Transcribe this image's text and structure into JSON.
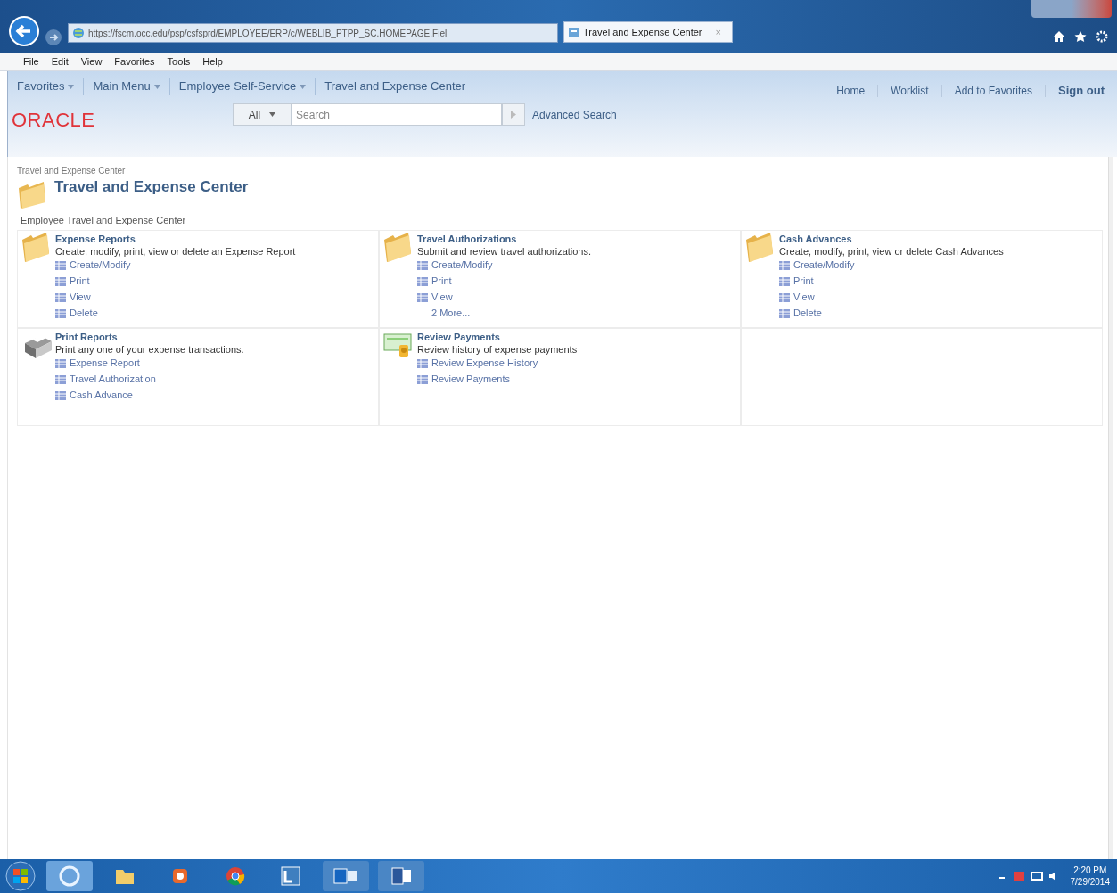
{
  "browser": {
    "address": "https://fscm.occ.edu/psp/csfsprd/EMPLOYEE/ERP/c/WEBLIB_PTPP_SC.HOMEPAGE.Fiel",
    "tabs": [
      {
        "label": "Travel and Expense Center",
        "selected": true,
        "close": "×"
      }
    ],
    "menu": [
      "File",
      "Edit",
      "View",
      "Favorites",
      "Tools",
      "Help"
    ]
  },
  "navbar": {
    "items": [
      {
        "label": "Favorites",
        "kind": "dropdown"
      },
      {
        "label": "Main Menu",
        "kind": "dropdown"
      },
      {
        "label": "Employee Self-Service",
        "kind": "dropdown"
      },
      {
        "label": "Travel and Expense Center",
        "kind": "plain"
      }
    ]
  },
  "header": {
    "logo": "ORACLE",
    "scope": "All",
    "search": {
      "placeholder": "Search"
    },
    "advanced": "Advanced Search",
    "links": [
      "Home",
      "Worklist",
      "Add to Favorites",
      "Sign out"
    ]
  },
  "page": {
    "breadcrumb": "Travel and Expense Center",
    "title": "Travel and Expense Center",
    "section": "Employee Travel and Expense Center",
    "tiles": [
      {
        "kind": "folder",
        "title": "Expense Reports",
        "description": "Create, modify, print, view or delete an Expense Report",
        "links": [
          {
            "label": "Create/Modify",
            "kind": "link"
          },
          {
            "label": "Print",
            "kind": "link"
          },
          {
            "label": "View",
            "kind": "link"
          },
          {
            "label": "Delete",
            "kind": "link"
          }
        ]
      },
      {
        "kind": "folder",
        "title": "Travel Authorizations",
        "description": "Submit and review travel authorizations.",
        "links": [
          {
            "label": "Create/Modify",
            "kind": "link"
          },
          {
            "label": "Print",
            "kind": "link"
          },
          {
            "label": "View",
            "kind": "link"
          },
          {
            "label": "2 More...",
            "kind": "more"
          }
        ]
      },
      {
        "kind": "folder",
        "title": "Cash Advances",
        "description": "Create, modify, print, view or delete Cash Advances",
        "links": [
          {
            "label": "Create/Modify",
            "kind": "link"
          },
          {
            "label": "Print",
            "kind": "link"
          },
          {
            "label": "View",
            "kind": "link"
          },
          {
            "label": "Delete",
            "kind": "link"
          }
        ]
      },
      {
        "kind": "printer",
        "title": "Print Reports",
        "description": "Print any one of your expense transactions.",
        "links": [
          {
            "label": "Expense Report",
            "kind": "link"
          },
          {
            "label": "Travel Authorization",
            "kind": "link"
          },
          {
            "label": "Cash Advance",
            "kind": "link"
          }
        ]
      },
      {
        "kind": "payment",
        "title": "Review Payments",
        "description": "Review history of expense payments",
        "links": [
          {
            "label": "Review Expense History",
            "kind": "link"
          },
          {
            "label": "Review Payments",
            "kind": "link"
          }
        ]
      }
    ]
  },
  "taskbar": {
    "time": "2:20 PM",
    "date": "7/29/2014"
  }
}
